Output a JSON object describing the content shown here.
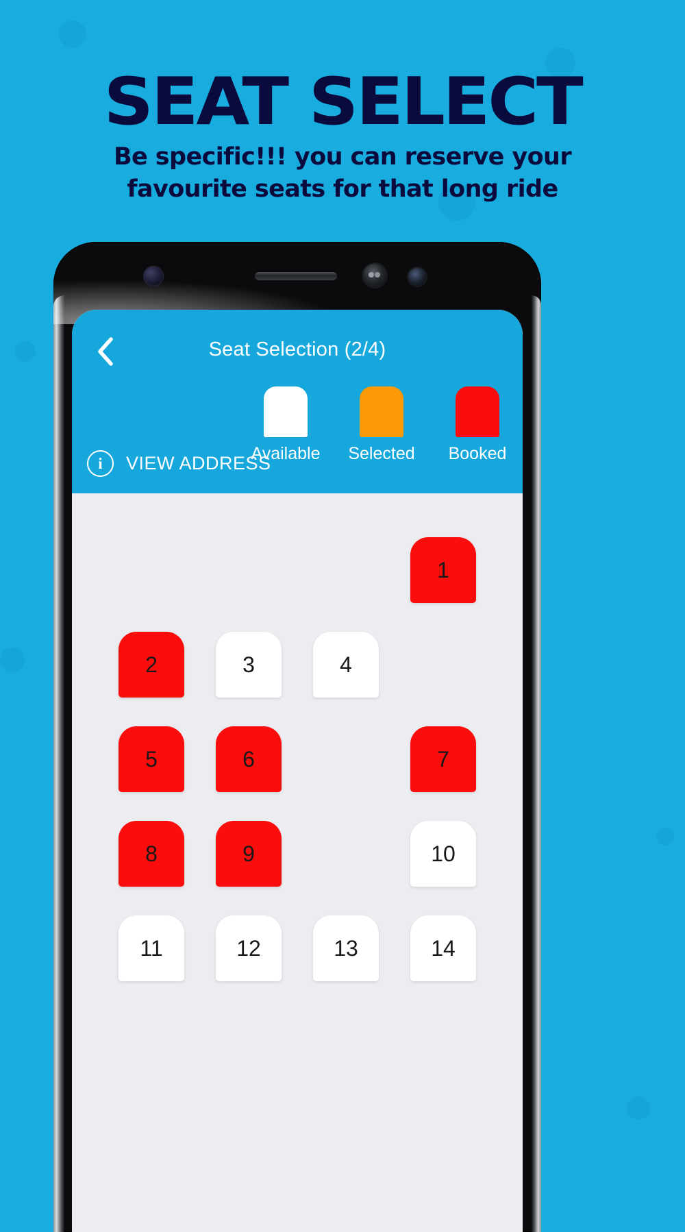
{
  "theme": {
    "background": "#18ACDF",
    "headline_color": "#0A0A3C",
    "app_header": "#16A7DC",
    "screen_bg": "#EBEDF1",
    "available": "#FFFFFF",
    "selected": "#FB9A06",
    "booked": "#FC0D0D",
    "seat_number_color": "#181818"
  },
  "hero": {
    "title": "SEAT SELECT",
    "subtitle": "Be specific!!! you can reserve your favourite seats for that long ride"
  },
  "app": {
    "header": {
      "back_icon": "chevron-left-icon",
      "title": "Seat Selection (2/4)",
      "selected_count": 2,
      "total_count": 4
    },
    "view_address": {
      "icon": "info-circle-icon",
      "label": "VIEW ADDRESS"
    },
    "legend": [
      {
        "label": "Available",
        "color": "#FFFFFF",
        "state": "available"
      },
      {
        "label": "Selected",
        "color": "#FB9A06",
        "state": "selected"
      },
      {
        "label": "Booked",
        "color": "#FC0D0D",
        "state": "booked"
      }
    ],
    "seat_map": {
      "columns": 4,
      "rows": [
        [
          {
            "number": "",
            "state": "empty"
          },
          {
            "number": "",
            "state": "empty"
          },
          {
            "number": "",
            "state": "empty"
          },
          {
            "number": "1",
            "state": "booked"
          }
        ],
        [
          {
            "number": "2",
            "state": "booked"
          },
          {
            "number": "3",
            "state": "available"
          },
          {
            "number": "4",
            "state": "available"
          },
          {
            "number": "",
            "state": "empty"
          }
        ],
        [
          {
            "number": "5",
            "state": "booked"
          },
          {
            "number": "6",
            "state": "booked"
          },
          {
            "number": "",
            "state": "empty"
          },
          {
            "number": "7",
            "state": "booked"
          }
        ],
        [
          {
            "number": "8",
            "state": "booked"
          },
          {
            "number": "9",
            "state": "booked"
          },
          {
            "number": "",
            "state": "empty"
          },
          {
            "number": "10",
            "state": "available"
          }
        ],
        [
          {
            "number": "11",
            "state": "available"
          },
          {
            "number": "12",
            "state": "available"
          },
          {
            "number": "13",
            "state": "available"
          },
          {
            "number": "14",
            "state": "available"
          }
        ]
      ]
    }
  },
  "device": {
    "sensors": [
      "front-camera-icon",
      "earpiece-speaker-icon",
      "iris-scanner-icon",
      "proximity-sensor-icon"
    ]
  }
}
